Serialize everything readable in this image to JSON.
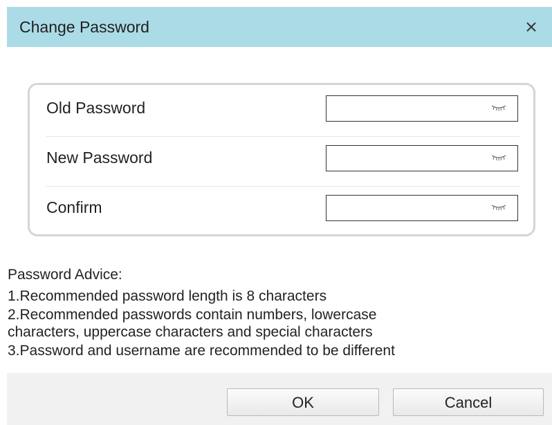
{
  "dialog": {
    "title": "Change Password",
    "close_symbol": "×",
    "title_bar_color": "#abdbe6"
  },
  "fields": [
    {
      "label": "Old Password",
      "value": "",
      "toggle_icon": "hidden-eye-icon"
    },
    {
      "label": "New Password",
      "value": "",
      "toggle_icon": "hidden-eye-icon"
    },
    {
      "label": "Confirm",
      "value": "",
      "toggle_icon": "hidden-eye-icon"
    }
  ],
  "advice": {
    "title": "Password Advice:",
    "items": [
      "1.Recommended password length is 8 characters",
      "2.Recommended passwords contain numbers, lowercase",
      "characters, uppercase characters and special characters",
      "3.Password and username are recommended to be different"
    ]
  },
  "buttons": {
    "ok_label": "OK",
    "cancel_label": "Cancel"
  }
}
